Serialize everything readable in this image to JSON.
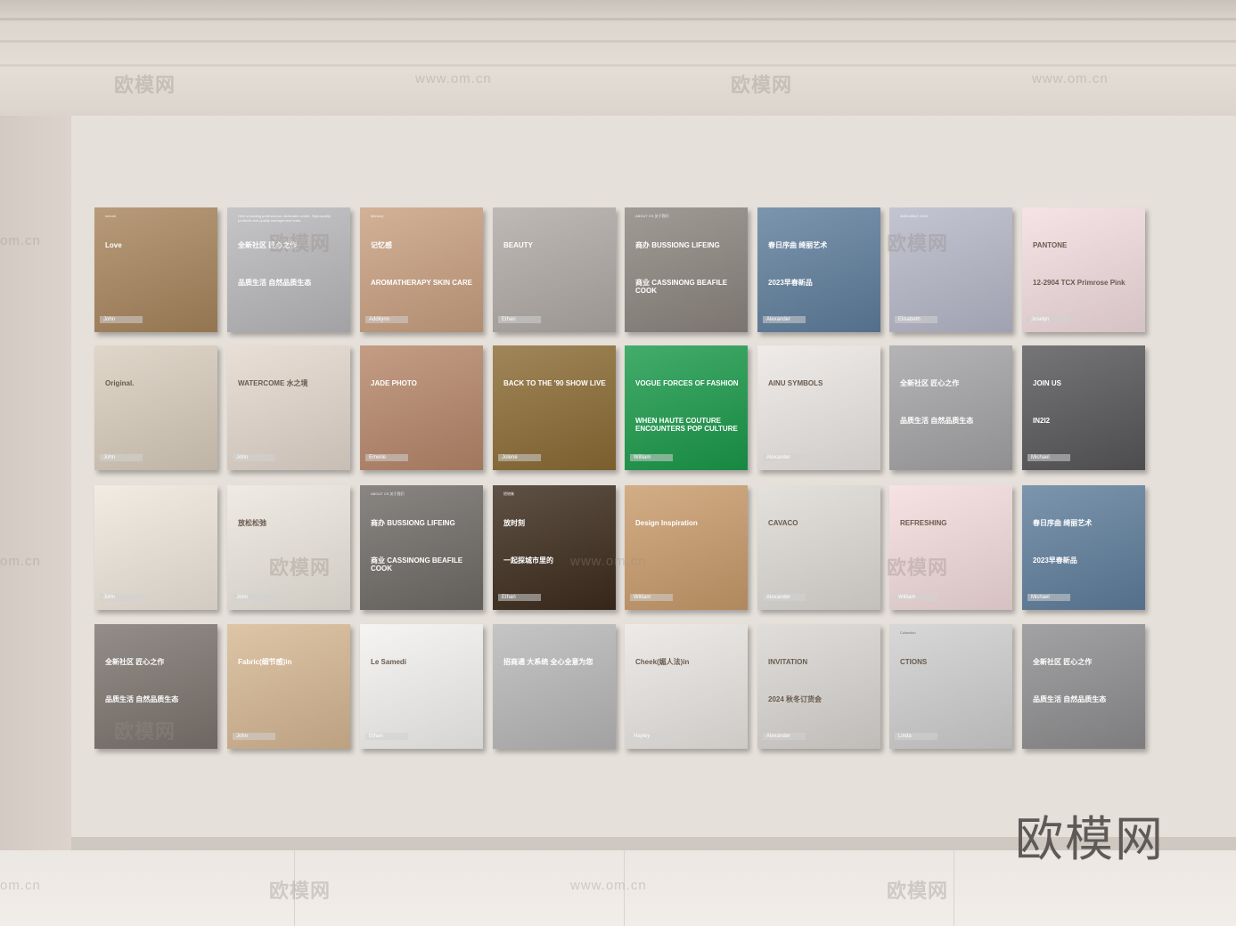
{
  "watermarks": {
    "brand": "欧模网",
    "url": "www.om.cn",
    "url_short": "om.cn",
    "logo": "欧模网"
  },
  "posters": [
    {
      "bg": "#a8855d",
      "label": "John",
      "title": "Love",
      "sub": "",
      "small": "lomodi"
    },
    {
      "bg": "#b9b8bb",
      "label": "",
      "title": "全新社区 匠心之作",
      "sub": "品质生活 自然品质生态",
      "small": "Here a leading professional, dedicated centre. High-quality products and quality management team."
    },
    {
      "bg": "#c9a080",
      "label": "Addilynn",
      "title": "记忆感",
      "sub": "AROMATHERAPY SKIN CARE",
      "small": "Memory"
    },
    {
      "bg": "#b0aaa6",
      "label": "Ethan",
      "title": "BEAUTY",
      "sub": "",
      "small": ""
    },
    {
      "bg": "#8c857e",
      "label": "",
      "title": "商办 BUSSIONG LIFEING",
      "sub": "商业 CASSINONG BEAFILE COOK",
      "small": "ABOUT CS 关于我们"
    },
    {
      "bg": "#5f7e9c",
      "label": "Alexander",
      "title": "春日序曲 绮丽艺术",
      "sub": "2023早春新品",
      "small": ""
    },
    {
      "bg": "#b7b8c9",
      "label": "Elisabeth",
      "title": "",
      "sub": "",
      "small": "AVAILABLE 2025"
    },
    {
      "bg": "#f3dde0",
      "label": "Joselyn",
      "title": "PANTONE",
      "sub": "12-2904 TCX Primrose Pink",
      "small": ""
    },
    {
      "bg": "#d9cdbd",
      "label": "John",
      "title": "Original.",
      "sub": "",
      "small": ""
    },
    {
      "bg": "#e4d8cd",
      "label": "John",
      "title": "WATERCOME 水之境",
      "sub": "",
      "small": ""
    },
    {
      "bg": "#b7876a",
      "label": "Emerie",
      "title": "JADE PHOTO",
      "sub": "",
      "small": ""
    },
    {
      "bg": "#8b6b34",
      "label": "Jolene",
      "title": "BACK TO THE '90 SHOW LIVE",
      "sub": "",
      "small": ""
    },
    {
      "bg": "#1a9a4a",
      "label": "William",
      "title": "VOGUE FORCES OF FASHION",
      "sub": "WHEN HAUTE COUTURE ENCOUNTERS POP CULTURE",
      "small": ""
    },
    {
      "bg": "#ebe7e4",
      "label": "Alexander",
      "title": "AINU SYMBOLS",
      "sub": "",
      "small": ""
    },
    {
      "bg": "#a4a3a5",
      "label": "",
      "title": "全新社区 匠心之作",
      "sub": "品质生活 自然品质生态",
      "small": ""
    },
    {
      "bg": "#57575a",
      "label": "Michael",
      "title": "JOIN US",
      "sub": "IN2I2",
      "small": ""
    },
    {
      "bg": "#efe7dc",
      "label": "John",
      "title": "",
      "sub": "",
      "small": ""
    },
    {
      "bg": "#ece7de",
      "label": "John",
      "title": "放松松弛",
      "sub": "",
      "small": ""
    },
    {
      "bg": "#6f6b67",
      "label": "",
      "title": "商办 BUSSIONG LIFEING",
      "sub": "商业 CASSINONG BEAFILE COOK",
      "small": "ABOUT CS 关于我们"
    },
    {
      "bg": "#3d2b1d",
      "label": "Ethan",
      "title": "放时刻",
      "sub": "一起探城市里的",
      "small": "栖物集"
    },
    {
      "bg": "#c99b6b",
      "label": "William",
      "title": "Design Inspiration",
      "sub": "",
      "small": ""
    },
    {
      "bg": "#dedbd6",
      "label": "Alexander",
      "title": "CAVACO",
      "sub": "",
      "small": ""
    },
    {
      "bg": "#f4dcdc",
      "label": "William",
      "title": "REFRESHING",
      "sub": "",
      "small": ""
    },
    {
      "bg": "#5f7e9c",
      "label": "Michael",
      "title": "春日序曲 绮丽艺术",
      "sub": "2023早春新品",
      "small": ""
    },
    {
      "bg": "#7c746e",
      "label": "",
      "title": "全新社区 匠心之作",
      "sub": "品质生活 自然品质生态",
      "small": ""
    },
    {
      "bg": "#d6b893",
      "label": "John",
      "title": "Fabric(细节感)in",
      "sub": "",
      "small": ""
    },
    {
      "bg": "#f3f2f0",
      "label": "Ethan",
      "title": "Le Samedi",
      "sub": "",
      "small": ""
    },
    {
      "bg": "#b9b8b9",
      "label": "",
      "title": "招商通 大系统 全心全意为您",
      "sub": "",
      "small": ""
    },
    {
      "bg": "#e9e6e3",
      "label": "Hayley",
      "title": "Cheek(媚人法)in",
      "sub": "",
      "small": ""
    },
    {
      "bg": "#d9d6d2",
      "label": "Alexander",
      "title": "INVITATION",
      "sub": "2024 秋冬订货会",
      "small": ""
    },
    {
      "bg": "#cfcfcf",
      "label": "Linda",
      "title": "CTIONS",
      "sub": "",
      "small": "Collection"
    },
    {
      "bg": "#8e8e90",
      "label": "",
      "title": "全新社区 匠心之作",
      "sub": "品质生活 自然品质生态",
      "small": ""
    }
  ]
}
